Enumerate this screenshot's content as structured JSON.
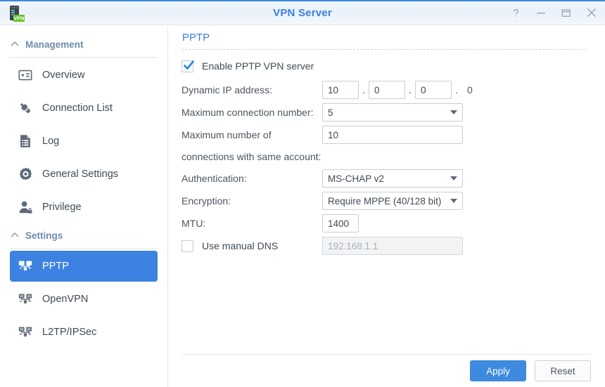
{
  "window": {
    "title": "VPN Server",
    "icon": "vpn-server-icon",
    "badge": "VPN",
    "controls": [
      {
        "name": "help-icon",
        "glyph": "?"
      },
      {
        "name": "minimize-icon",
        "glyph": "—"
      },
      {
        "name": "maximize-icon",
        "glyph": "▭"
      },
      {
        "name": "close-icon",
        "glyph": "✕"
      }
    ]
  },
  "sidebar": {
    "groups": [
      {
        "label": "Management",
        "chevron": "chevron-up-icon",
        "items": [
          {
            "label": "Overview",
            "icon": "id-card-icon",
            "selected": false
          },
          {
            "label": "Connection List",
            "icon": "plug-icon",
            "selected": false
          },
          {
            "label": "Log",
            "icon": "document-list-icon",
            "selected": false
          },
          {
            "label": "General Settings",
            "icon": "gear-icon",
            "selected": false
          },
          {
            "label": "Privilege",
            "icon": "user-lock-icon",
            "selected": false
          }
        ]
      },
      {
        "label": "Settings",
        "chevron": "chevron-up-icon",
        "items": [
          {
            "label": "PPTP",
            "icon": "network-monitors-icon",
            "selected": true
          },
          {
            "label": "OpenVPN",
            "icon": "network-monitors-icon",
            "selected": false
          },
          {
            "label": "L2TP/IPSec",
            "icon": "network-monitors-icon",
            "selected": false
          }
        ]
      }
    ]
  },
  "main": {
    "title": "PPTP",
    "enable": {
      "label": "Enable PPTP VPN server",
      "checked": true
    },
    "dynamic_ip": {
      "label": "Dynamic IP address:",
      "octet1": "10",
      "octet2": "0",
      "octet3": "0",
      "octet4": "0",
      "separator": "."
    },
    "max_connections": {
      "label": "Maximum connection number:",
      "value": "5"
    },
    "max_same_account": {
      "label_line1": "Maximum number of",
      "label_line2": "connections with same account:",
      "value": "10"
    },
    "authentication": {
      "label": "Authentication:",
      "value": "MS-CHAP v2"
    },
    "encryption": {
      "label": "Encryption:",
      "value": "Require MPPE (40/128 bit)"
    },
    "mtu": {
      "label": "MTU:",
      "value": "1400"
    },
    "manual_dns": {
      "label": "Use manual DNS",
      "checked": false,
      "value": "192.168.1.1"
    }
  },
  "footer": {
    "apply_label": "Apply",
    "reset_label": "Reset"
  },
  "colors": {
    "accent": "#3d8ade",
    "title": "#3c80e0",
    "selected_item": "#3d82e0",
    "label_text": "#4b5560",
    "group_title": "#6f8cae"
  }
}
